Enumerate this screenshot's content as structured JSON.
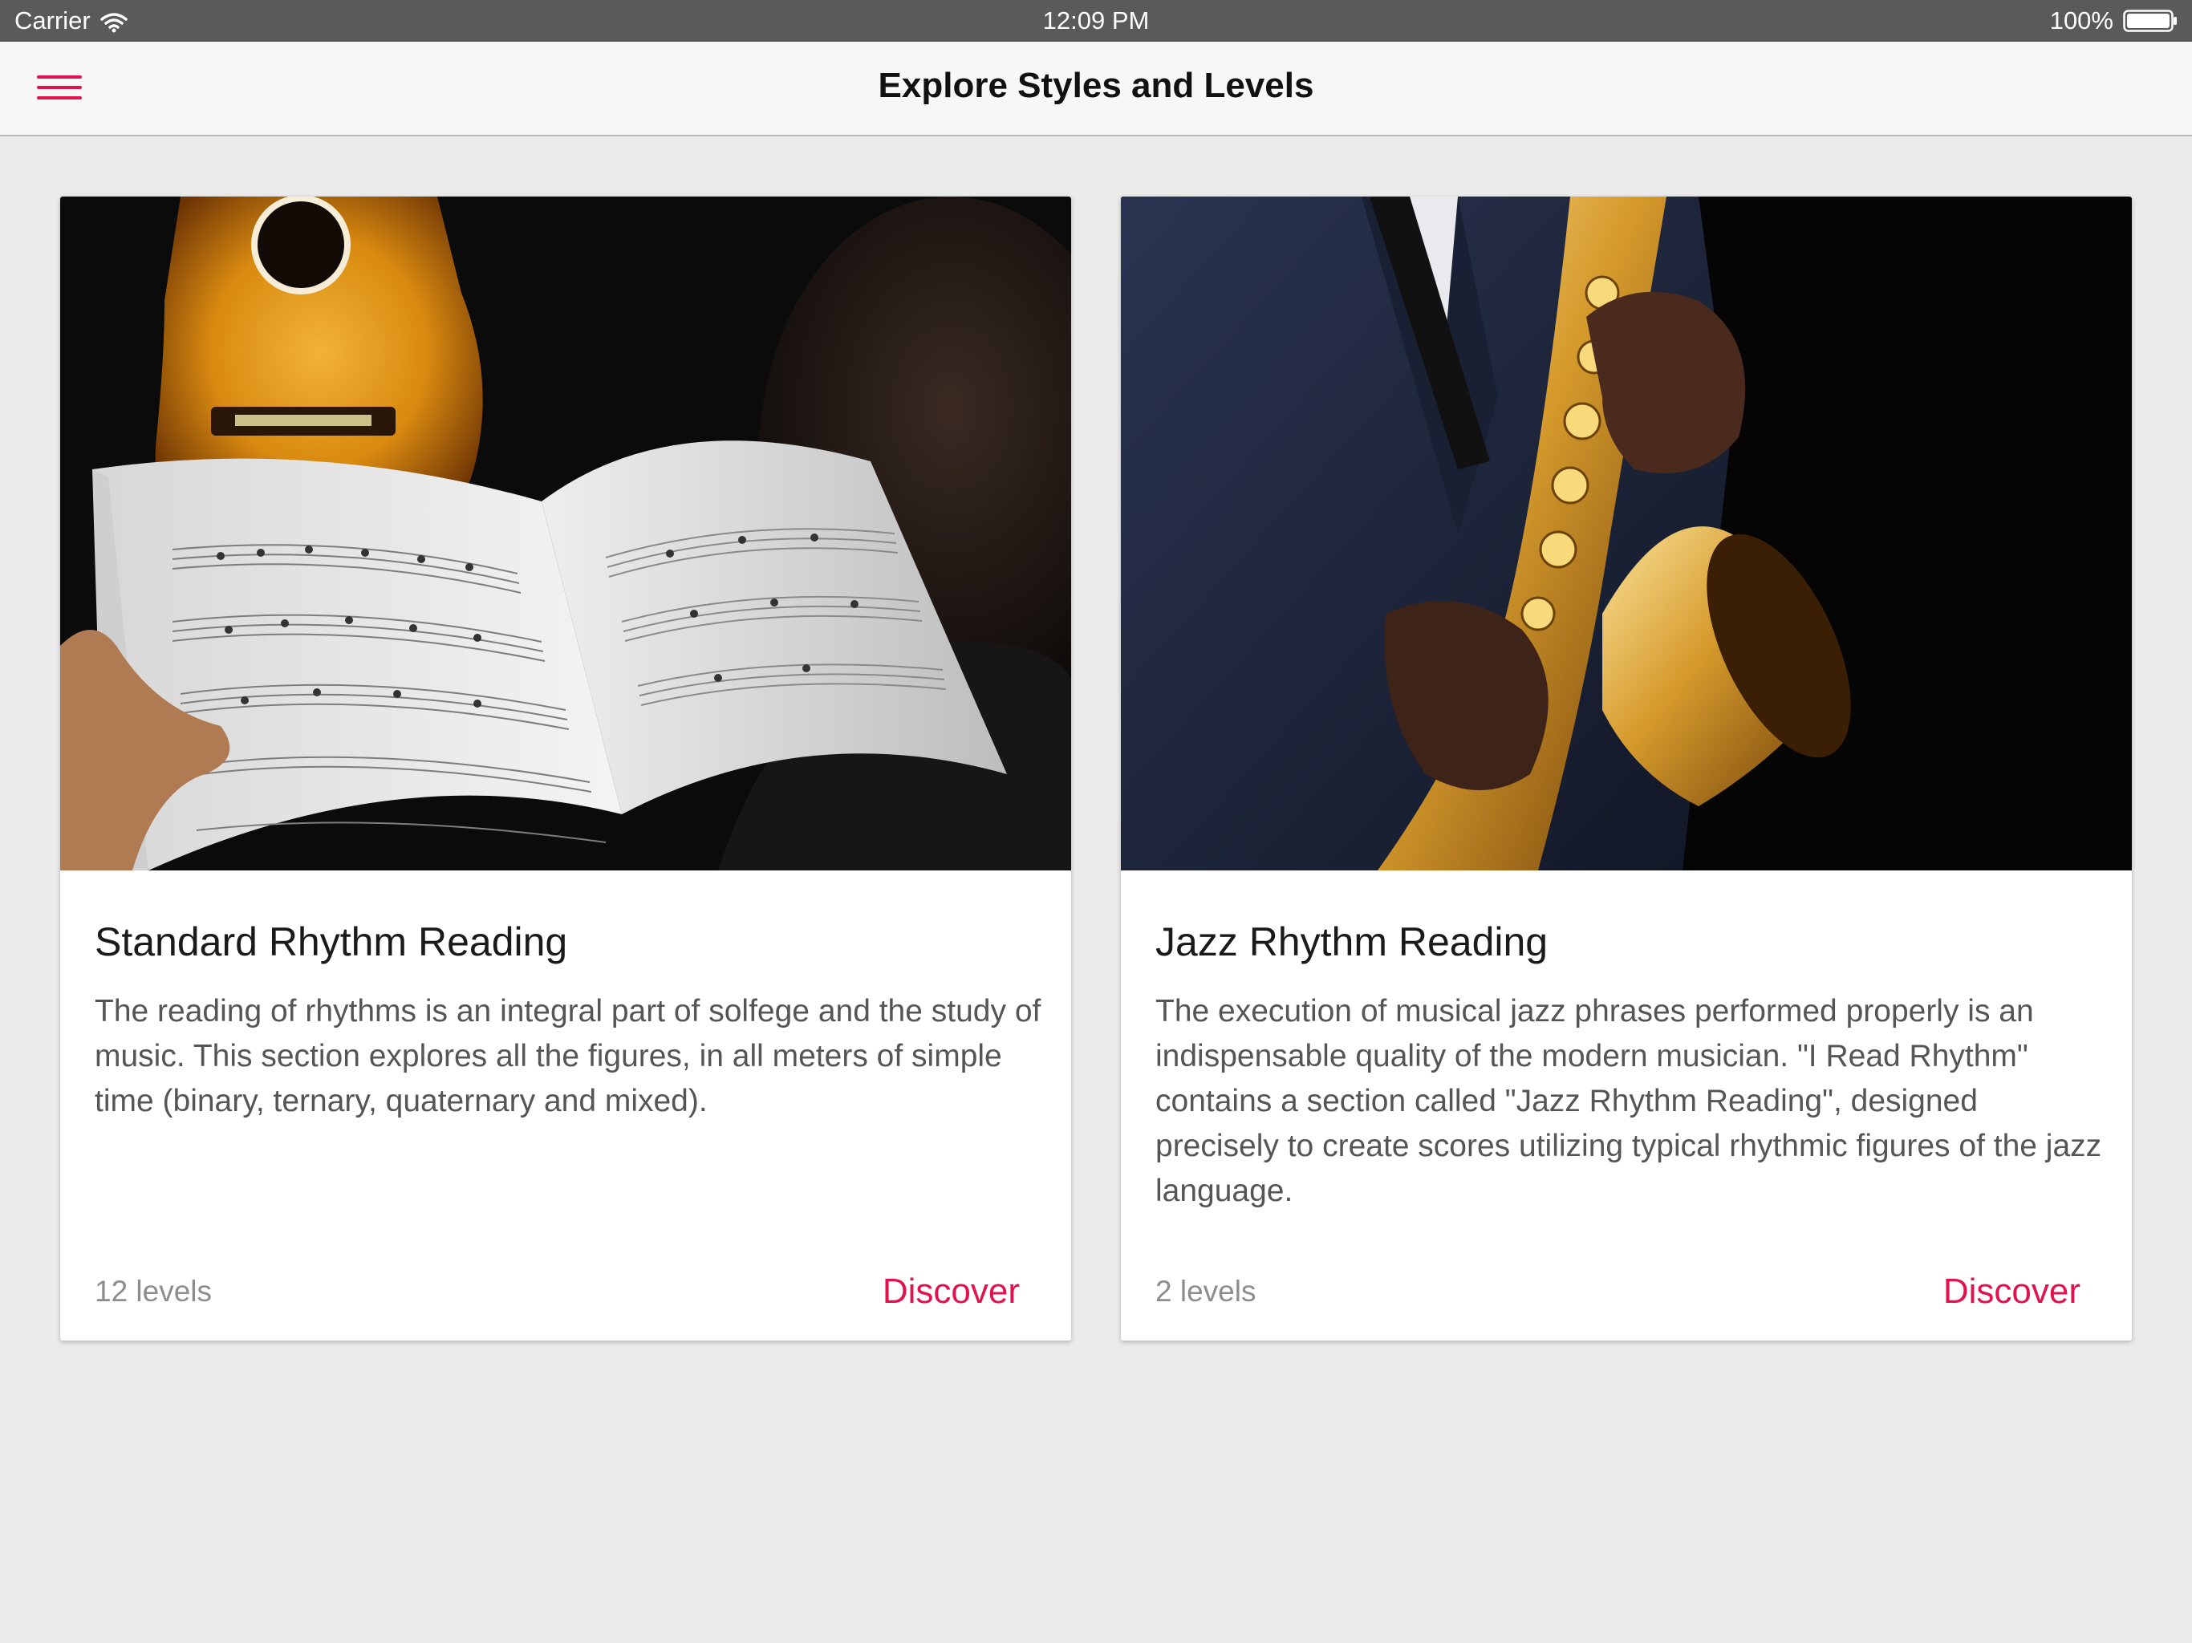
{
  "status_bar": {
    "carrier": "Carrier",
    "time": "12:09 PM",
    "battery": "100%"
  },
  "nav": {
    "title": "Explore Styles and Levels"
  },
  "colors": {
    "accent": "#e0134f",
    "background": "#ebebeb",
    "status_bar": "#5a5a5a"
  },
  "cards": [
    {
      "title": "Standard Rhythm Reading",
      "description": "The reading of rhythms is an integral part of solfege and the study of music. This section explores all the figures, in all meters of simple time (binary, ternary, quaternary and mixed).",
      "levels": "12 levels",
      "action": "Discover"
    },
    {
      "title": "Jazz Rhythm Reading",
      "description": "The execution of musical jazz phrases performed properly is an indispensable quality of the modern musician. \"I Read Rhythm\" contains a section called \"Jazz Rhythm Reading\", designed precisely to create scores utilizing typical rhythmic figures of the jazz language.",
      "levels": "2 levels",
      "action": "Discover"
    }
  ]
}
